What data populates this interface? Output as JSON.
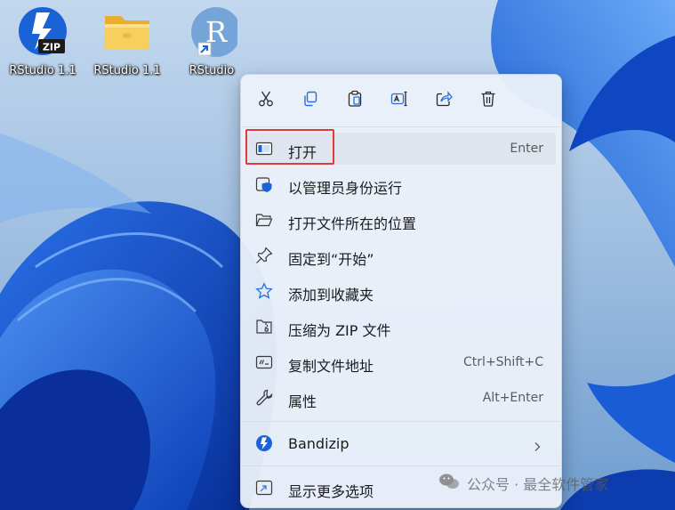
{
  "desktop": {
    "icons": [
      {
        "label": "RStudio 1.1",
        "icon": "zip-archive-icon",
        "badge": "ZIP"
      },
      {
        "label": "RStudio 1.1",
        "icon": "folder-icon"
      },
      {
        "label": "RStudio",
        "icon": "rstudio-shortcut-icon",
        "letter": "R"
      }
    ]
  },
  "context_menu": {
    "quick_actions": [
      {
        "name": "cut",
        "icon": "scissors-icon"
      },
      {
        "name": "copy",
        "icon": "copy-icon"
      },
      {
        "name": "paste",
        "icon": "paste-icon"
      },
      {
        "name": "rename",
        "icon": "rename-icon"
      },
      {
        "name": "share",
        "icon": "share-icon"
      },
      {
        "name": "delete",
        "icon": "trash-icon"
      }
    ],
    "items": [
      {
        "label": "打开",
        "shortcut": "Enter",
        "icon": "open-icon"
      },
      {
        "label": "以管理员身份运行",
        "shortcut": "",
        "icon": "admin-shield-icon"
      },
      {
        "label": "打开文件所在的位置",
        "shortcut": "",
        "icon": "folder-open-icon"
      },
      {
        "label": "固定到“开始”",
        "shortcut": "",
        "icon": "pin-icon"
      },
      {
        "label": "添加到收藏夹",
        "shortcut": "",
        "icon": "star-icon"
      },
      {
        "label": "压缩为 ZIP 文件",
        "shortcut": "",
        "icon": "zip-file-icon"
      },
      {
        "label": "复制文件地址",
        "shortcut": "Ctrl+Shift+C",
        "icon": "copy-path-icon"
      },
      {
        "label": "属性",
        "shortcut": "Alt+Enter",
        "icon": "wrench-icon"
      },
      {
        "label": "Bandizip",
        "shortcut": "",
        "icon": "bandizip-icon",
        "submenu": true
      },
      {
        "label": "显示更多选项",
        "shortcut": "",
        "icon": "more-options-icon"
      }
    ],
    "highlighted_item": "打开"
  },
  "watermark": {
    "text": "公众号 · 最全软件管家",
    "icon": "wechat-icon"
  },
  "colors": {
    "highlight_border": "#e03a3a",
    "accent_blue": "#1a63d6",
    "folder_yellow": "#f3c64c"
  }
}
